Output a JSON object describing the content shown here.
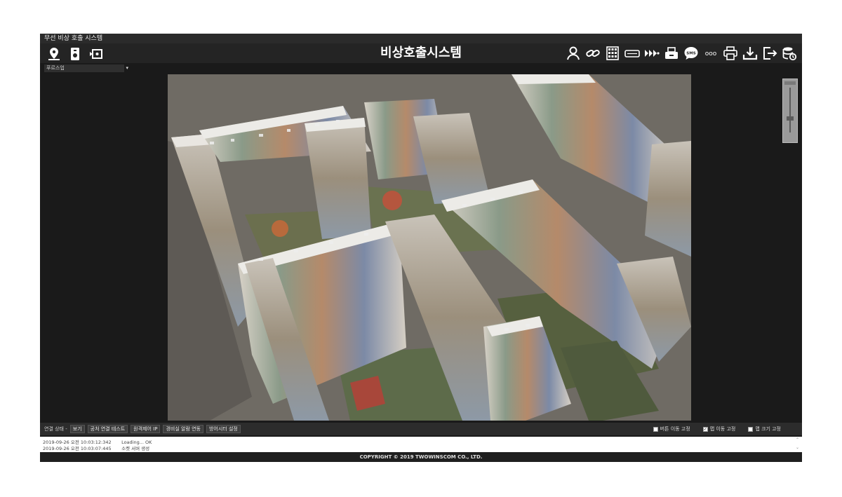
{
  "window": {
    "title": "무선 비상 호출 시스템"
  },
  "header": {
    "app_title": "비상호출시스템"
  },
  "toolbar": {
    "left_icons": [
      "map-pin-icon",
      "device-icon",
      "camera-icon"
    ],
    "right_icons": [
      "user-icon",
      "link-icon",
      "keypad-icon",
      "receiver-icon",
      "arrows-icon",
      "printer-device-icon",
      "sms-icon",
      "more-icon",
      "print-icon",
      "download-icon",
      "logout-icon",
      "database-icon"
    ],
    "sms_label": "SMS",
    "more_label": "ooo"
  },
  "selector": {
    "value": "푸르스업"
  },
  "zoom_slider": {
    "level": 0.7
  },
  "statusbar": {
    "label": "연결 상태 -",
    "buttons": [
      "보기",
      "공처 연결 테스트",
      "원격제어 IP",
      "경비실 알람 연동",
      "방어시터 설정"
    ],
    "checkboxes": [
      {
        "label": "버튼 이동 고정",
        "checked": false
      },
      {
        "label": "맵 이동 고정",
        "checked": true
      },
      {
        "label": "맵 크기 고정",
        "checked": false
      }
    ]
  },
  "log": [
    {
      "time": "2019-09-26 오전 10:03:12:342",
      "message": "Loading... OK"
    },
    {
      "time": "2019-09-26 오전 10:03:07:445",
      "message": "소켓 서버 생성"
    }
  ],
  "footer": {
    "copyright": "COPYRIGHT © 2019 TWOWINSCOM CO., LTD."
  },
  "colors": {
    "background": "#1a1a1a",
    "toolbar": "#242424",
    "text": "#ffffff"
  }
}
